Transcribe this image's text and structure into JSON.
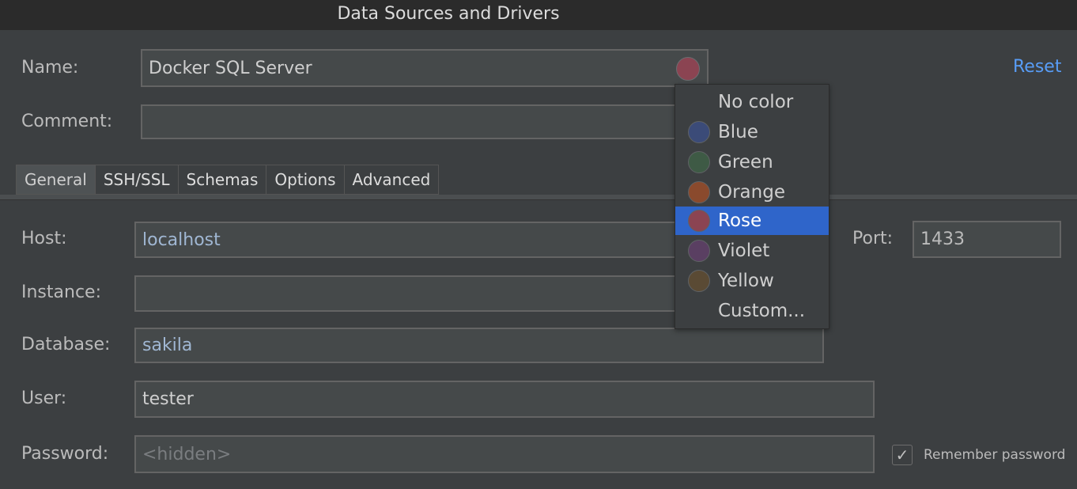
{
  "window": {
    "title": "Data Sources and Drivers"
  },
  "header": {
    "name_label": "Name:",
    "name_value": "Docker SQL Server",
    "comment_label": "Comment:",
    "comment_value": "",
    "reset_label": "Reset",
    "selected_color": "#8b4452"
  },
  "tabs": [
    {
      "label": "General",
      "active": true
    },
    {
      "label": "SSH/SSL"
    },
    {
      "label": "Schemas"
    },
    {
      "label": "Options"
    },
    {
      "label": "Advanced"
    }
  ],
  "general": {
    "host_label": "Host:",
    "host_value": "localhost",
    "port_label": "Port:",
    "port_value": "1433",
    "instance_label": "Instance:",
    "instance_value": "",
    "database_label": "Database:",
    "database_value": "sakila",
    "user_label": "User:",
    "user_value": "tester",
    "password_label": "Password:",
    "password_placeholder": "<hidden>",
    "remember_password_label": "Remember password",
    "remember_password_checked": true,
    "checkmark": "✓"
  },
  "color_menu": {
    "items": [
      {
        "label": "No color",
        "color": null
      },
      {
        "label": "Blue",
        "color": "#3b4b78"
      },
      {
        "label": "Green",
        "color": "#3e5a45"
      },
      {
        "label": "Orange",
        "color": "#8a4a2d"
      },
      {
        "label": "Rose",
        "color": "#8b4452",
        "selected": true
      },
      {
        "label": "Violet",
        "color": "#5a3f62"
      },
      {
        "label": "Yellow",
        "color": "#5a4a34"
      },
      {
        "label": "Custom...",
        "color": null
      }
    ]
  }
}
